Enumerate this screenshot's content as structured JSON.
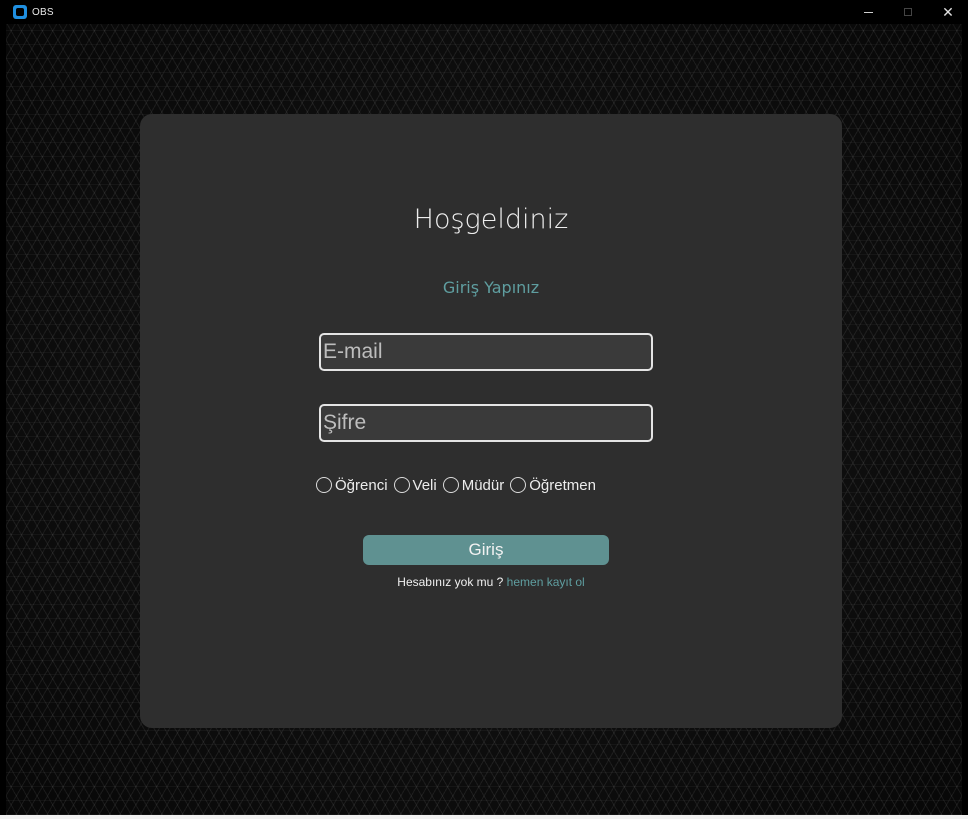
{
  "window": {
    "title": "OBS",
    "controls": {
      "minimize": "–",
      "maximize": "□",
      "close": "✕"
    }
  },
  "login": {
    "heading": "Hoşgeldiniz",
    "subheading": "Giriş Yapınız",
    "email_placeholder": "E-mail",
    "password_placeholder": "Şifre",
    "roles": [
      "Öğrenci",
      "Veli",
      "Müdür",
      "Öğretmen"
    ],
    "login_label": "Giriş",
    "signup_prompt": "Hesabınız yok mu ? ",
    "signup_link": "hemen kayıt ol"
  },
  "colors": {
    "accent": "#5f9ea0",
    "button": "#5f9191",
    "card": "#2e2e2e"
  }
}
